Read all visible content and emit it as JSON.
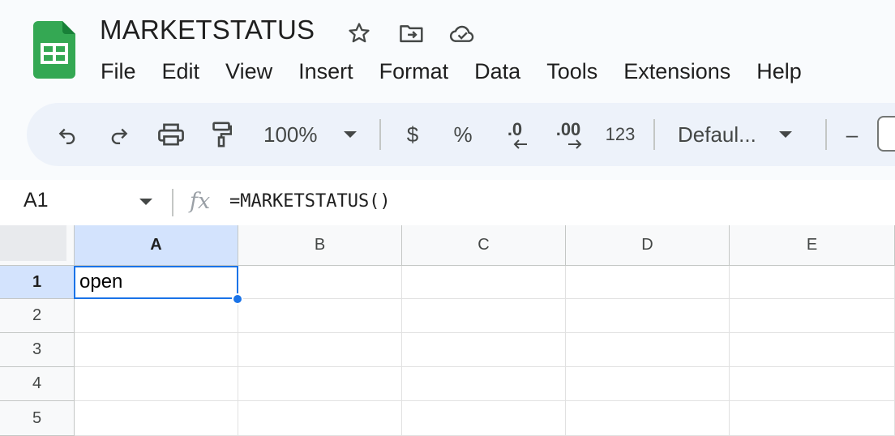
{
  "document": {
    "title": "MARKETSTATUS",
    "icons": [
      "star-icon",
      "move-to-folder-icon",
      "cloud-saved-icon"
    ]
  },
  "menu": [
    "File",
    "Edit",
    "View",
    "Insert",
    "Format",
    "Data",
    "Tools",
    "Extensions",
    "Help"
  ],
  "toolbar": {
    "zoom": "100%",
    "currency": "$",
    "percent": "%",
    "decrease_decimal": ".0",
    "increase_decimal": ".00",
    "number_format": "123",
    "font": "Defaul...",
    "font_size_decrease": "–"
  },
  "formula_bar": {
    "cell_ref": "A1",
    "fx_label": "fx",
    "formula": "=MARKETSTATUS()"
  },
  "grid": {
    "columns": [
      "A",
      "B",
      "C",
      "D",
      "E"
    ],
    "rows": [
      "1",
      "2",
      "3",
      "4",
      "5"
    ],
    "cells": {
      "A1": "open"
    },
    "selected_cell": "A1"
  },
  "colors": {
    "accent": "#1a73e8",
    "sheets_green": "#0f9d58",
    "toolbar_bg": "#edf2fa",
    "header_selected": "#d3e3fd"
  }
}
